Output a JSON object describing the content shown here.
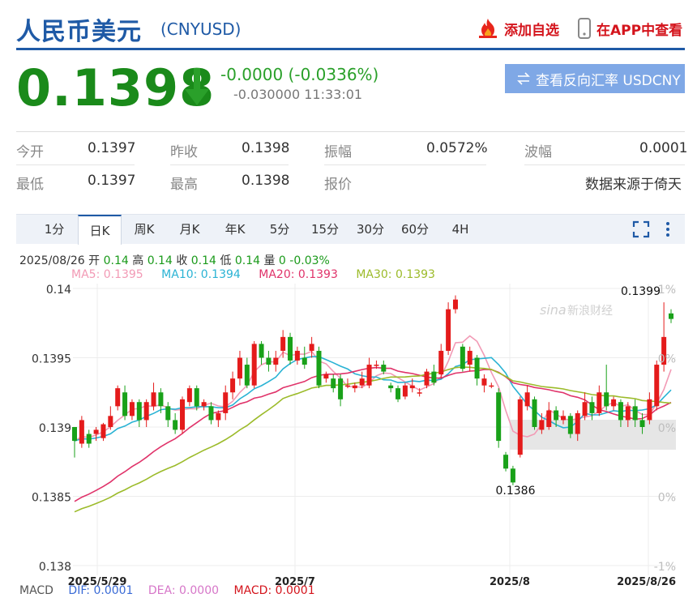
{
  "header": {
    "title": "人民币美元",
    "code": "(CNYUSD)",
    "add_watch": "添加自选",
    "app_view": "在APP中查看"
  },
  "quote": {
    "price": "0.1398",
    "change": "-0.0000 (-0.0336%)",
    "sub": "-0.030000 11:33:01",
    "reverse_btn": "查看反向汇率 USDCNY",
    "direction": "down"
  },
  "stats": {
    "open_label": "今开",
    "open": "0.1397",
    "prev_label": "昨收",
    "prev": "0.1398",
    "amp_label": "振幅",
    "amp": "0.0572%",
    "wave_label": "波幅",
    "wave": "0.0001",
    "low_label": "最低",
    "low": "0.1397",
    "high_label": "最高",
    "high": "0.1398",
    "quote_label": "报价",
    "source": "数据来源于倚天"
  },
  "tabs": [
    "1分",
    "日K",
    "周K",
    "月K",
    "年K",
    "5分",
    "15分",
    "30分",
    "60分",
    "4H"
  ],
  "active_tab": "日K",
  "info": {
    "date": "2025/08/26",
    "open_l": "开",
    "open": "0.14",
    "high_l": "高",
    "high": "0.14",
    "close_l": "收",
    "close": "0.14",
    "low_l": "低",
    "low": "0.14",
    "vol_l": "量",
    "vol": "0",
    "pct": "-0.03%"
  },
  "ma": {
    "ma5": "MA5: 0.1395",
    "ma10": "MA10: 0.1394",
    "ma20": "MA20: 0.1393",
    "ma30": "MA30: 0.1393"
  },
  "macd": {
    "label": "MACD",
    "dif": "DIF: 0.0001",
    "dea": "DEA: 0.0000",
    "macd": "MACD: 0.0001"
  },
  "watermark": "新浪财经",
  "colors": {
    "up": "#e41b1b",
    "down": "#19a119",
    "ma5": "#f29ab5",
    "ma10": "#2ab3d4",
    "ma20": "#e0336a",
    "ma30": "#9cbb2a",
    "brand": "#1f5aa6"
  },
  "chart_data": {
    "type": "candlestick",
    "y_ticks": [
      "0.14",
      "0.1395",
      "0.139",
      "0.1385",
      "0.138"
    ],
    "x_ticks": [
      "2025/5/29",
      "2025/7",
      "2025/8",
      "2025/8/26"
    ],
    "pct_ticks": [
      "1%",
      "0%",
      "0%",
      "0%",
      "-1%"
    ],
    "ylim": [
      0.138,
      0.14
    ],
    "max_label": "0.1399",
    "min_label": "0.1386"
  }
}
